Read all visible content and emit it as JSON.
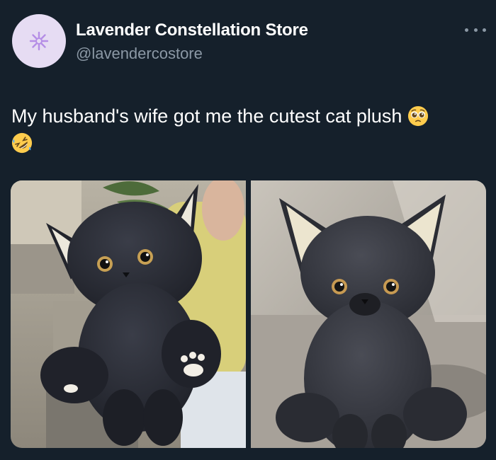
{
  "author": {
    "name": "Lavender Constellation Store",
    "handle": "@lavendercostore",
    "avatar_icon": "sparkle-flower-icon",
    "avatar_bg": "#e6dcf3",
    "avatar_accent": "#b58ee6"
  },
  "tweet": {
    "text": "My husband's wife got me the cutest cat plush",
    "emojis": [
      "pleading-face-emoji",
      "rolling-on-floor-laughing-emoji"
    ]
  },
  "media": {
    "count": 2,
    "photos": [
      {
        "name": "photo-plush-held",
        "icon": "black-cat-plush-image"
      },
      {
        "name": "photo-plush-sitting",
        "icon": "black-cat-plush-image"
      }
    ]
  },
  "colors": {
    "background": "#15202b",
    "text_primary": "#ffffff",
    "text_secondary": "#8b98a5"
  }
}
